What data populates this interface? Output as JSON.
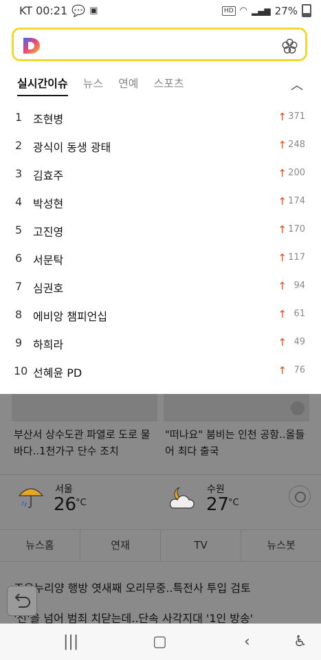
{
  "status": {
    "carrier_time": "KT 00:21",
    "hd": "HD",
    "battery": "27%"
  },
  "search": {
    "placeholder": ""
  },
  "tabs": [
    {
      "label": "실시간이슈",
      "active": true
    },
    {
      "label": "뉴스"
    },
    {
      "label": "연예"
    },
    {
      "label": "스포츠"
    }
  ],
  "collapse_icon": "chevron-up",
  "ranking": [
    {
      "rank": "1",
      "keyword": "조현병",
      "arrow": "↑",
      "count": "371"
    },
    {
      "rank": "2",
      "keyword": "광식이 동생 광태",
      "arrow": "↑",
      "count": "248"
    },
    {
      "rank": "3",
      "keyword": "김효주",
      "arrow": "↑",
      "count": "200"
    },
    {
      "rank": "4",
      "keyword": "박성현",
      "arrow": "↑",
      "count": "174"
    },
    {
      "rank": "5",
      "keyword": "고진영",
      "arrow": "↑",
      "count": "170"
    },
    {
      "rank": "6",
      "keyword": "서문탁",
      "arrow": "↑",
      "count": "117"
    },
    {
      "rank": "7",
      "keyword": "심권호",
      "arrow": "↑",
      "count": "94"
    },
    {
      "rank": "8",
      "keyword": "에비앙 챔피언십",
      "arrow": "↑",
      "count": "61"
    },
    {
      "rank": "9",
      "keyword": "하희라",
      "arrow": "↑",
      "count": "49"
    },
    {
      "rank": "10",
      "keyword": "선혜윤 PD",
      "arrow": "↑",
      "count": "76"
    }
  ],
  "cards": [
    {
      "headline": "부산서 상수도관 파열로 도로 물바다..1천가구 단수 조치"
    },
    {
      "headline": "\"떠나요\" 붐비는 인천 공항..올들어 최다 출국"
    }
  ],
  "weather": [
    {
      "city": "서울",
      "temp": "26",
      "unit": "°C",
      "icon": "rain-umbrella-icon"
    },
    {
      "city": "수원",
      "temp": "27",
      "unit": "°C",
      "icon": "partly-cloudy-night-icon"
    }
  ],
  "news_nav": [
    "뉴스홈",
    "연재",
    "TV",
    "뉴스봇"
  ],
  "news_items": [
    "조우누리양 행방 엿새째 오리무중..특전사 투입 검토",
    "'선'을 넘어 범죄 치닫는데..단속 사각지대 '1인 방송'"
  ],
  "colors": {
    "search_border": "#f1d92a",
    "rank_up": "#e64a19"
  }
}
